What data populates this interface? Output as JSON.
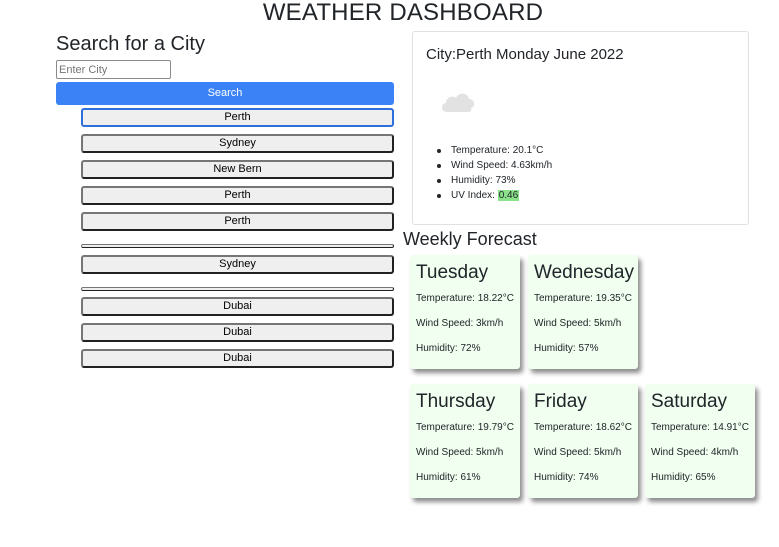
{
  "header": {
    "title": "WEATHER DASHBOARD"
  },
  "search": {
    "heading": "Search for a City",
    "placeholder": "Enter City",
    "value": "",
    "button_label": "Search"
  },
  "history": [
    {
      "label": "Perth",
      "focused": true
    },
    {
      "label": "Sydney"
    },
    {
      "label": "New Bern"
    },
    {
      "label": "Perth"
    },
    {
      "label": "Perth"
    },
    {
      "label": ""
    },
    {
      "label": "Sydney"
    },
    {
      "label": ""
    },
    {
      "label": "Dubai"
    },
    {
      "label": "Dubai"
    },
    {
      "label": "Dubai"
    }
  ],
  "current": {
    "title": "City:Perth Monday June 2022",
    "icon": "cloud-icon",
    "temperature_label": "Temperature: 20.1°C",
    "wind_label": "Wind Speed: 4.63km/h",
    "humidity_label": "Humidity: 73%",
    "uv_label": "UV Index:",
    "uv_value": "0.46",
    "uv_color": "#8be28b"
  },
  "forecast": {
    "heading": "Weekly Forecast",
    "days": [
      {
        "name": "Tuesday",
        "temperature": "Temperature: 18.22°C",
        "wind": "Wind Speed: 3km/h",
        "humidity": "Humidity: 72%"
      },
      {
        "name": "Wednesday",
        "temperature": "Temperature: 19.35°C",
        "wind": "Wind Speed: 5km/h",
        "humidity": "Humidity: 57%"
      },
      {
        "name": "Thursday",
        "temperature": "Temperature: 19.79°C",
        "wind": "Wind Speed: 5km/h",
        "humidity": "Humidity: 61%"
      },
      {
        "name": "Friday",
        "temperature": "Temperature: 18.62°C",
        "wind": "Wind Speed: 5km/h",
        "humidity": "Humidity: 74%"
      },
      {
        "name": "Saturday",
        "temperature": "Temperature: 14.91°C",
        "wind": "Wind Speed: 4km/h",
        "humidity": "Humidity: 65%"
      }
    ]
  },
  "colors": {
    "accent": "#3b82f6",
    "forecast_card_bg": "#f0fff0"
  }
}
